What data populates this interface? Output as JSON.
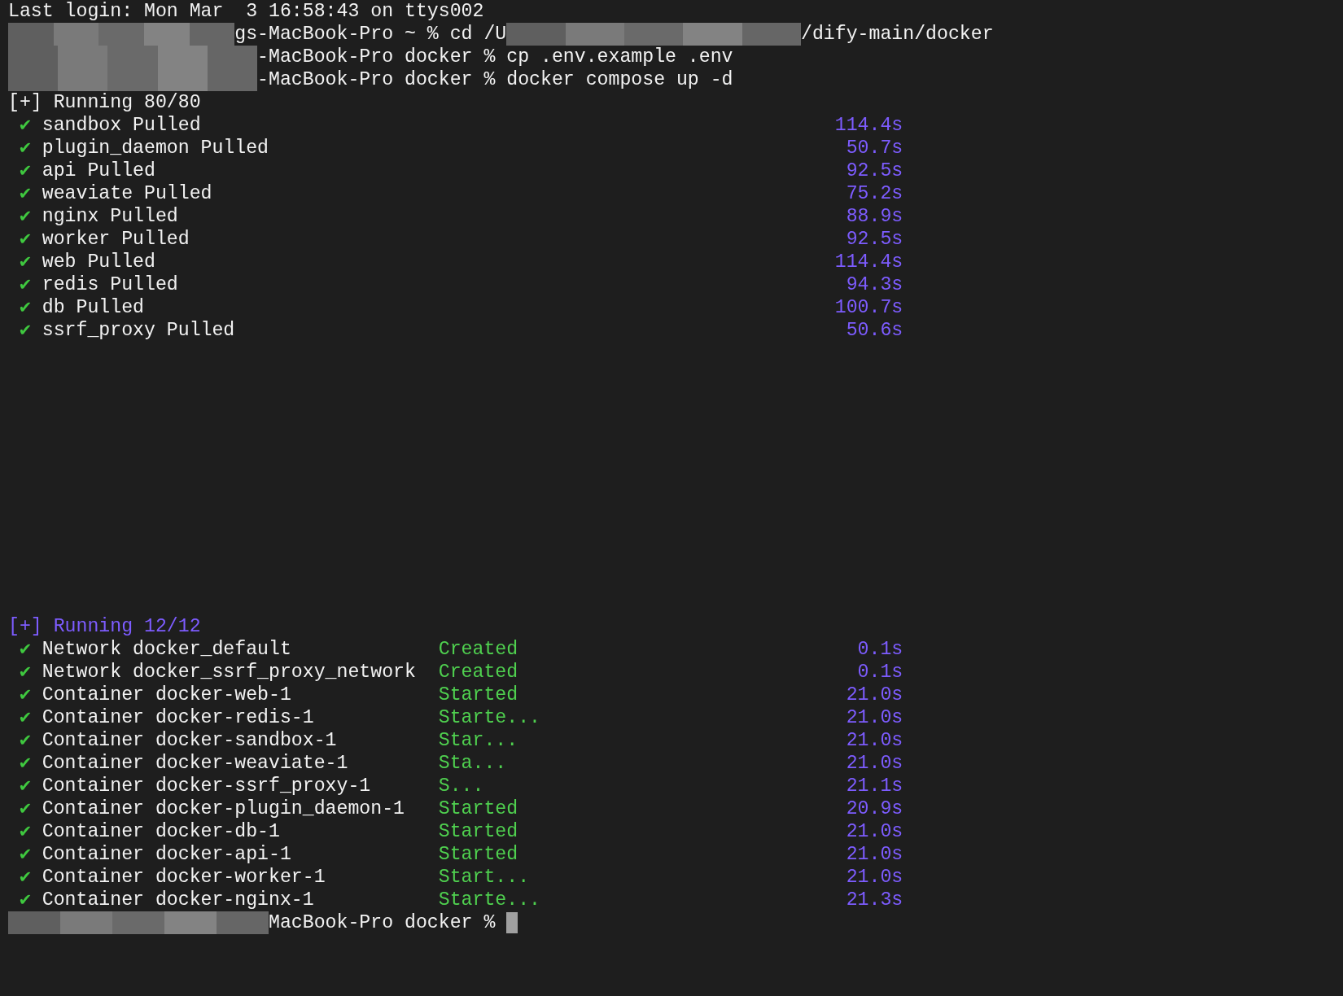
{
  "last_login": "Last login: Mon Mar  3 16:58:43 on ttys002",
  "commands": [
    {
      "text": "gs-MacBook-Pro ~ % cd /U",
      "text_after": "/dify-main/docker"
    },
    {
      "text": "-MacBook-Pro docker % cp .env.example .env"
    },
    {
      "text": "-MacBook-Pro docker % docker compose up -d"
    }
  ],
  "pull": {
    "header": "[+] Running 80/80",
    "items": [
      {
        "mark": "✔",
        "name": "sandbox Pulled",
        "time": "114.4s"
      },
      {
        "mark": "✔",
        "name": "plugin_daemon Pulled",
        "time": "50.7s"
      },
      {
        "mark": "✔",
        "name": "api Pulled",
        "time": "92.5s"
      },
      {
        "mark": "✔",
        "name": "weaviate Pulled",
        "time": "75.2s"
      },
      {
        "mark": "✔",
        "name": "nginx Pulled",
        "time": "88.9s"
      },
      {
        "mark": "✔",
        "name": "worker Pulled",
        "time": "92.5s"
      },
      {
        "mark": "✔",
        "name": "web Pulled",
        "time": "114.4s"
      },
      {
        "mark": "✔",
        "name": "redis Pulled",
        "time": "94.3s"
      },
      {
        "mark": "✔",
        "name": "db Pulled",
        "time": "100.7s"
      },
      {
        "mark": "✔",
        "name": "ssrf_proxy Pulled",
        "time": "50.6s"
      }
    ]
  },
  "start": {
    "header": "[+] Running 12/12",
    "items": [
      {
        "mark": "✔",
        "name": "Network docker_default",
        "status": "Created",
        "time": "0.1s"
      },
      {
        "mark": "✔",
        "name": "Network docker_ssrf_proxy_network",
        "status": "Created",
        "time": "0.1s"
      },
      {
        "mark": "✔",
        "name": "Container docker-web-1",
        "status": "Started",
        "time": "21.0s"
      },
      {
        "mark": "✔",
        "name": "Container docker-redis-1",
        "status": "Starte...",
        "time": "21.0s"
      },
      {
        "mark": "✔",
        "name": "Container docker-sandbox-1",
        "status": "Star...",
        "time": "21.0s"
      },
      {
        "mark": "✔",
        "name": "Container docker-weaviate-1",
        "status": "Sta...",
        "time": "21.0s"
      },
      {
        "mark": "✔",
        "name": "Container docker-ssrf_proxy-1",
        "status": "S...",
        "time": "21.1s"
      },
      {
        "mark": "✔",
        "name": "Container docker-plugin_daemon-1",
        "status": "Started",
        "time": "20.9s"
      },
      {
        "mark": "✔",
        "name": "Container docker-db-1",
        "status": "Started",
        "time": "21.0s"
      },
      {
        "mark": "✔",
        "name": "Container docker-api-1",
        "status": "Started",
        "time": "21.0s"
      },
      {
        "mark": "✔",
        "name": "Container docker-worker-1",
        "status": "Start...",
        "time": "21.0s"
      },
      {
        "mark": "✔",
        "name": "Container docker-nginx-1",
        "status": "Starte...",
        "time": "21.3s"
      }
    ]
  },
  "prompt": {
    "text": "MacBook-Pro docker %"
  }
}
